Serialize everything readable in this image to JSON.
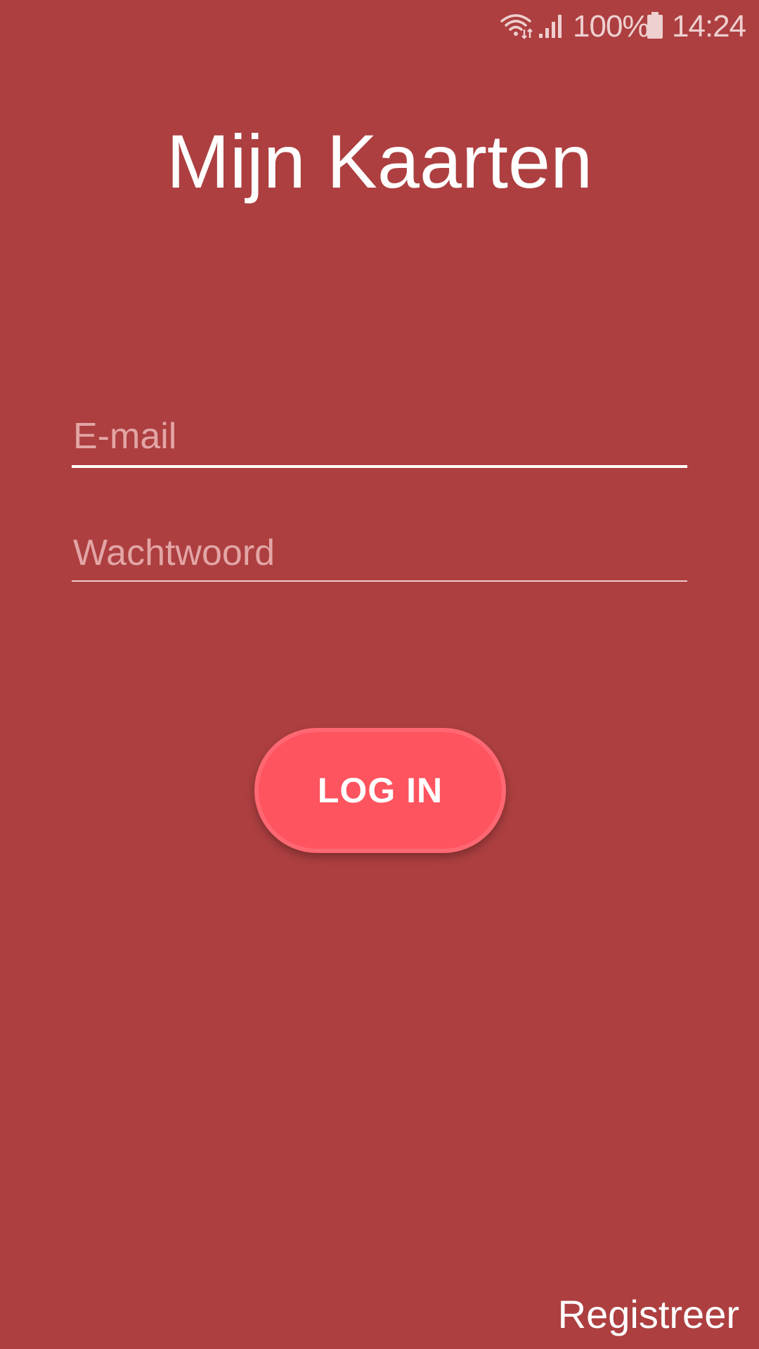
{
  "status_bar": {
    "battery_percent": "100%",
    "time": "14:24",
    "icons": [
      "wifi-icon",
      "signal-icon",
      "battery-icon"
    ]
  },
  "app": {
    "title": "Mijn Kaarten"
  },
  "login_form": {
    "email": {
      "placeholder": "E-mail",
      "value": ""
    },
    "password": {
      "placeholder": "Wachtwoord",
      "value": ""
    },
    "login_button_label": "LOG IN"
  },
  "footer": {
    "register_label": "Registreer"
  },
  "colors": {
    "background": "#ad3f40",
    "button": "#fe545f",
    "text": "#ffffff",
    "placeholder": "#e3a5a5"
  }
}
